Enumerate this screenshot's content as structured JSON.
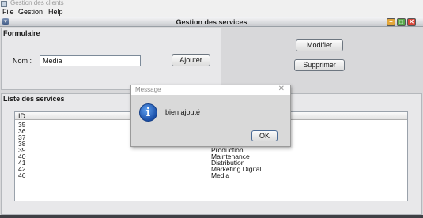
{
  "app": {
    "title": "Gestion des clients"
  },
  "menu": [
    "File",
    "Gestion",
    "Help"
  ],
  "internal_frame": {
    "title": "Gestion des services",
    "sys_menu_glyph": "▾",
    "min_glyph": "–",
    "max_glyph": "□",
    "close_glyph": "✕"
  },
  "form": {
    "section_title": "Formulaire",
    "nom_label": "Nom :",
    "nom_value": "Media",
    "add_label": "Ajouter"
  },
  "actions": {
    "modify_label": "Modifier",
    "delete_label": "Supprimer"
  },
  "list": {
    "section_title": "Liste des services",
    "columns": [
      "ID",
      ""
    ],
    "rows": [
      {
        "id": "35",
        "name": ""
      },
      {
        "id": "36",
        "name": ""
      },
      {
        "id": "37",
        "name": ""
      },
      {
        "id": "38",
        "name": ""
      },
      {
        "id": "39",
        "name": "Production"
      },
      {
        "id": "40",
        "name": "Maintenance"
      },
      {
        "id": "41",
        "name": "Distribution"
      },
      {
        "id": "42",
        "name": "Marketing Digital"
      },
      {
        "id": "46",
        "name": "Media"
      }
    ]
  },
  "dialog": {
    "title": "Message",
    "message": "bien ajouté",
    "ok_label": "OK",
    "close_glyph": "✕",
    "icon_glyph": "i"
  },
  "colors": {
    "window_btn_min": "#e3a63a",
    "window_btn_max": "#58a84a",
    "window_btn_close": "#d9463a",
    "info_icon": "#1f5fbf"
  }
}
